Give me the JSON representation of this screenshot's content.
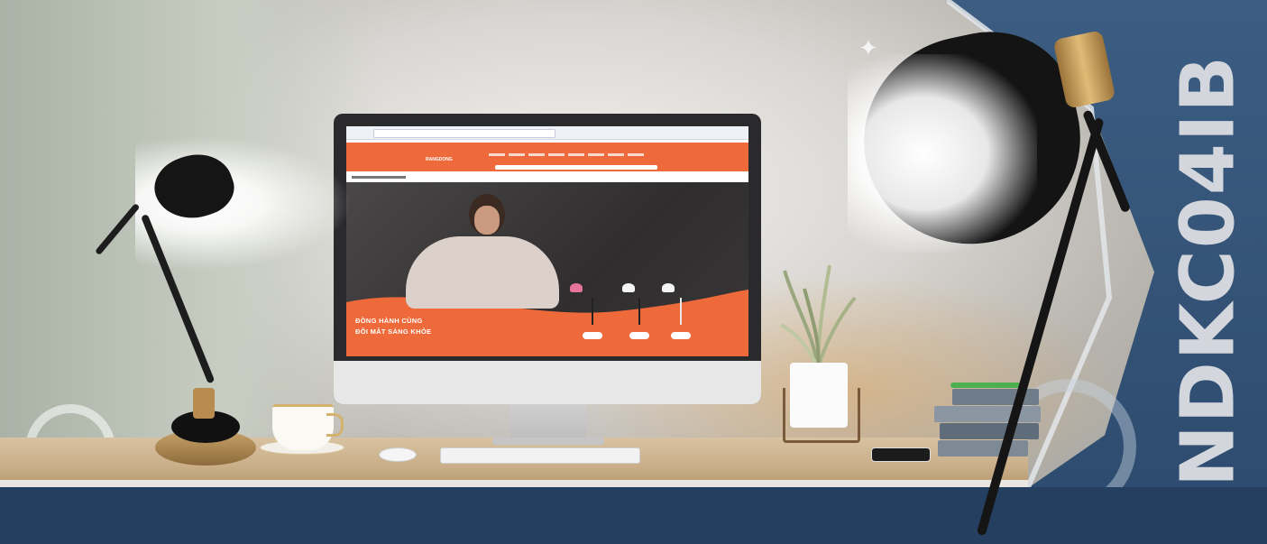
{
  "banner": {
    "product_code": "NDKC04IB",
    "colors": {
      "navy": "#2c4a6d",
      "accent_orange": "#ef6a3a",
      "brand_text": "#d3d6dc",
      "gold": "#c9a46a"
    }
  },
  "screen": {
    "site_logo": "RANGDONG",
    "hero_line1": "ĐỒNG HÀNH CÙNG",
    "hero_line2": "ĐÔI MẮT SÁNG KHỎE"
  },
  "icons": {
    "sparkle": "four-point-star-icon"
  }
}
